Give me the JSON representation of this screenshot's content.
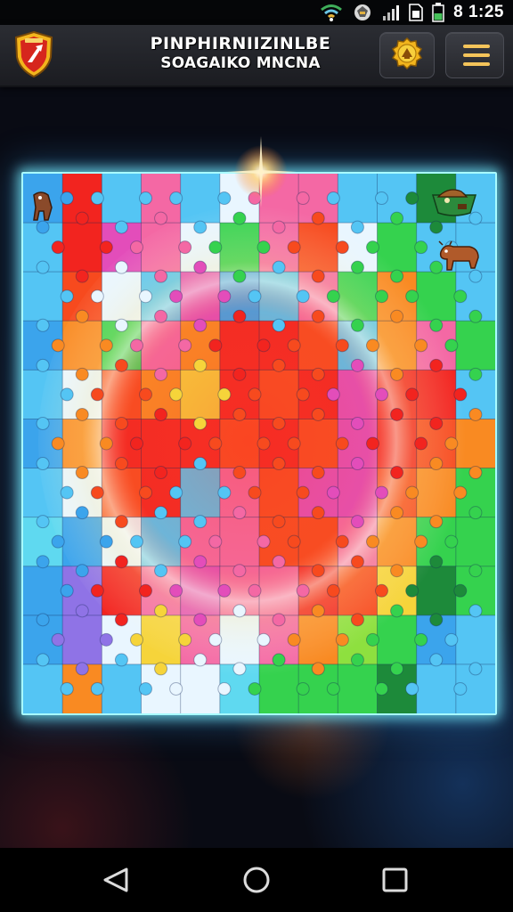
{
  "status_bar": {
    "time": "8 1:25",
    "icons": [
      "wifi-icon",
      "notification-icon",
      "signal-icon",
      "sim-icon",
      "battery-icon"
    ]
  },
  "header": {
    "title_line1": "PINPHIRNIIZINLBE",
    "title_line2": "SOAGAIKO MNCNA",
    "logo": "shield-logo",
    "buttons": [
      "achievement-button",
      "menu-button"
    ],
    "colors": {
      "bar": "#232429",
      "menu_icon": "#f4c45a",
      "badge_gold": "#f2b51d",
      "logo_red": "#d6261d"
    }
  },
  "board": {
    "rows": 11,
    "cols": 12,
    "frame_glow": "#7ef0ff",
    "palette": {
      "blue": "#3ba4ec",
      "sky": "#54c5f4",
      "cyan": "#5fd9f0",
      "red": "#f2241f",
      "red_orange": "#f74a1e",
      "orange": "#f98a22",
      "pink": "#f468a4",
      "magenta": "#e34dba",
      "yellow": "#f6d43a",
      "green": "#35d24e",
      "dark_green": "#1d8a3a",
      "lime": "#8ee03f",
      "purple": "#8f73e6",
      "white": "#e9f6ff"
    },
    "tiles": [
      [
        "blue",
        "red",
        "sky",
        "pink",
        "sky",
        "white",
        "pink",
        "pink",
        "sky",
        "sky",
        "dark_green",
        "sky"
      ],
      [
        "sky",
        "red",
        "magenta",
        "pink",
        "white",
        "green",
        "pink",
        "red_orange",
        "white",
        "green",
        "sky",
        "sky"
      ],
      [
        "sky",
        "red_orange",
        "white",
        "sky",
        "magenta",
        "blue",
        "sky",
        "pink",
        "green",
        "orange",
        "green",
        "sky"
      ],
      [
        "blue",
        "orange",
        "green",
        "pink",
        "orange",
        "red",
        "red",
        "red_orange",
        "sky",
        "orange",
        "pink",
        "green"
      ],
      [
        "sky",
        "white",
        "red_orange",
        "orange",
        "yellow",
        "red",
        "red_orange",
        "red",
        "magenta",
        "red",
        "red",
        "sky"
      ],
      [
        "blue",
        "orange",
        "red",
        "red",
        "red",
        "red_orange",
        "red",
        "red_orange",
        "magenta",
        "red",
        "red_orange",
        "orange"
      ],
      [
        "sky",
        "white",
        "red_orange",
        "red",
        "sky",
        "pink",
        "red_orange",
        "magenta",
        "magenta",
        "red_orange",
        "orange",
        "green"
      ],
      [
        "cyan",
        "blue",
        "white",
        "sky",
        "pink",
        "pink",
        "red_orange",
        "red_orange",
        "pink",
        "orange",
        "green",
        "green"
      ],
      [
        "blue",
        "purple",
        "red",
        "pink",
        "magenta",
        "pink",
        "pink",
        "red",
        "red_orange",
        "yellow",
        "dark_green",
        "green"
      ],
      [
        "blue",
        "purple",
        "white",
        "yellow",
        "pink",
        "white",
        "pink",
        "orange",
        "lime",
        "green",
        "blue",
        "sky"
      ],
      [
        "sky",
        "orange",
        "sky",
        "white",
        "white",
        "cyan",
        "green",
        "green",
        "green",
        "dark_green",
        "sky",
        "sky"
      ]
    ],
    "creatures": [
      "critter-figure",
      "boat-creature",
      "ox-creature"
    ]
  },
  "nav": {
    "buttons": [
      "back-button",
      "home-button",
      "recent-apps-button"
    ]
  }
}
